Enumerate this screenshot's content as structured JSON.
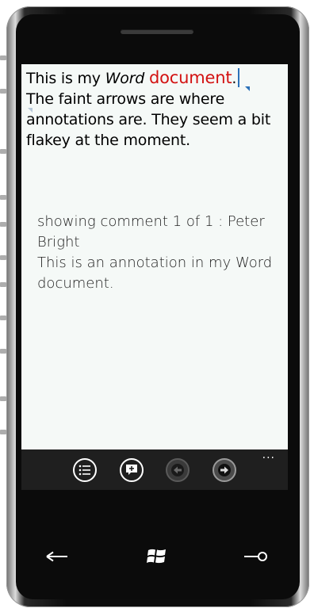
{
  "document": {
    "line1_plain": "This is my ",
    "line1_italic": "Word",
    "line1_red": "document",
    "line1_end": ".",
    "rest": "The faint arrows are where annotations are. They seem a bit flakey at the moment."
  },
  "comment": {
    "header": "showing comment 1 of 1 : Peter Bright",
    "body": "This is an annotation in my Word document."
  },
  "appbar": {
    "buttons": [
      "list-icon",
      "add-comment-icon",
      "previous-icon",
      "next-icon"
    ],
    "more": "..."
  },
  "hardware": [
    "back-icon",
    "windows-start-icon",
    "search-icon"
  ],
  "colors": {
    "accent": "#2b71b8",
    "highlight_red": "#d31212",
    "document_bg": "#f5f9f7",
    "appbar_bg": "#1f1f1f"
  }
}
